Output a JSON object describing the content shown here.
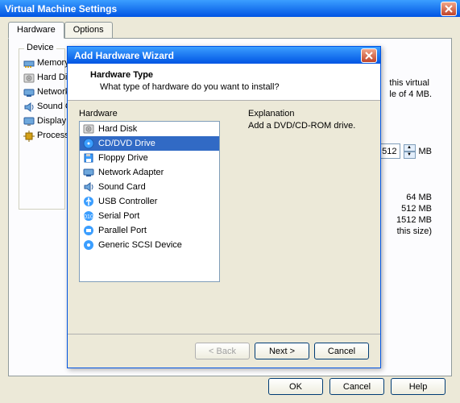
{
  "main_window": {
    "title": "Virtual Machine Settings",
    "tabs": [
      "Hardware",
      "Options"
    ],
    "active_tab": 0,
    "device_group_label": "Device",
    "devices": [
      {
        "label": "Memory",
        "icon": "memory-icon"
      },
      {
        "label": "Hard Disk",
        "icon": "harddisk-icon"
      },
      {
        "label": "Network A",
        "icon": "network-icon"
      },
      {
        "label": "Sound Ca",
        "icon": "sound-icon"
      },
      {
        "label": "Display",
        "icon": "display-icon"
      },
      {
        "label": "Processor",
        "icon": "processor-icon"
      }
    ],
    "right_info_line1": "this virtual",
    "right_info_line2": "le of 4 MB.",
    "memory_value": "512",
    "memory_unit": "MB",
    "mem_stats": [
      "64 MB",
      "512 MB",
      "1512 MB",
      "this size)"
    ],
    "buttons": {
      "ok": "OK",
      "cancel": "Cancel",
      "help": "Help"
    }
  },
  "wizard": {
    "title": "Add Hardware Wizard",
    "header_title": "Hardware Type",
    "header_sub": "What type of hardware do you want to install?",
    "hardware_label": "Hardware",
    "explanation_label": "Explanation",
    "explanation_text": "Add a DVD/CD-ROM drive.",
    "selected_index": 1,
    "items": [
      {
        "label": "Hard Disk",
        "icon": "harddisk-icon"
      },
      {
        "label": "CD/DVD Drive",
        "icon": "cd-icon"
      },
      {
        "label": "Floppy Drive",
        "icon": "floppy-icon"
      },
      {
        "label": "Network Adapter",
        "icon": "network-icon"
      },
      {
        "label": "Sound Card",
        "icon": "sound-icon"
      },
      {
        "label": "USB Controller",
        "icon": "usb-icon"
      },
      {
        "label": "Serial Port",
        "icon": "serial-icon"
      },
      {
        "label": "Parallel Port",
        "icon": "parallel-icon"
      },
      {
        "label": "Generic SCSI Device",
        "icon": "scsi-icon"
      }
    ],
    "buttons": {
      "back": "< Back",
      "next": "Next >",
      "cancel": "Cancel"
    }
  }
}
